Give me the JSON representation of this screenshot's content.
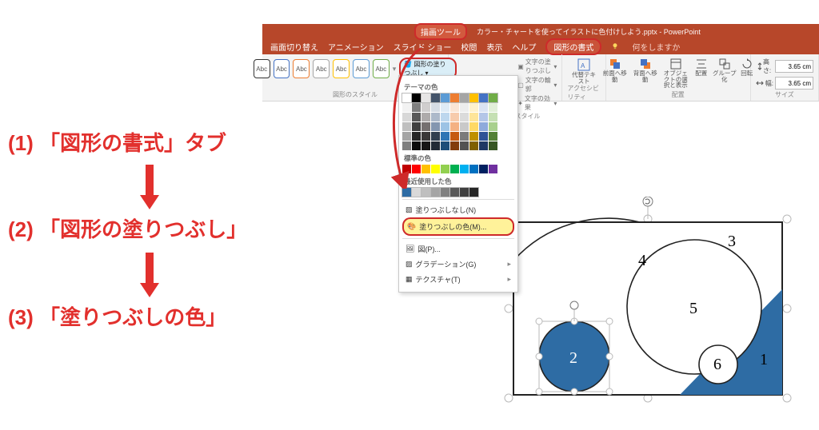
{
  "titlebar": {
    "tool_tab": "描画ツール",
    "doc_title": "カラー・チャートを使ってイラストに色付けしよう.pptx - PowerPoint"
  },
  "tabs": {
    "items": [
      "画面切り替え",
      "アニメーション",
      "スライド ショー",
      "校閲",
      "表示",
      "ヘルプ"
    ],
    "active": "図形の書式",
    "tell_me": "何をしますか"
  },
  "ribbon": {
    "style_label": "Abc",
    "fill_button": "図形の塗りつぶし",
    "shape_styles_group": "図形のスタイル",
    "wordart_group": "ワードアートのスタイル",
    "wa_fill": "文字の塗りつぶし",
    "wa_outline": "文字の輪郭",
    "wa_effects": "文字の効果",
    "alt_text": "代替テキスト",
    "acc_group": "アクセシビリティ",
    "arrange": {
      "forward": "前面へ移動",
      "backward": "背面へ移動",
      "selpane": "オブジェクトの選択と表示",
      "align": "配置",
      "group": "グループ化",
      "rotate": "回転"
    },
    "arrange_group": "配置",
    "size_group": "サイズ",
    "height_label": "高さ:",
    "width_label": "幅:",
    "height": "3.65 cm",
    "width": "3.65 cm"
  },
  "dropdown": {
    "theme_label": "テーマの色",
    "standard_label": "標準の色",
    "recent_label": "最近使用した色",
    "no_fill": "塗りつぶしなし(N)",
    "more_fill": "塗りつぶしの色(M)...",
    "picture": "図(P)...",
    "gradient": "グラデーション(G)",
    "texture": "テクスチャ(T)"
  },
  "annotations": {
    "a1": "(1) 「図形の書式」タブ",
    "a2": "(2) 「図形の塗りつぶし」",
    "a3": "(3) 「塗りつぶしの色」"
  },
  "shape_nums": [
    "1",
    "2",
    "3",
    "4",
    "5",
    "6"
  ],
  "swatches_theme_row1": [
    "#ffffff",
    "#000000",
    "#e7e6e6",
    "#44546a",
    "#5b9bd5",
    "#ed7d31",
    "#a5a5a5",
    "#ffc000",
    "#4472c4",
    "#70ad47"
  ],
  "swatches_theme_tints": [
    [
      "#f2f2f2",
      "#7f7f7f",
      "#d0cece",
      "#d6dce4",
      "#deebf6",
      "#fbe5d5",
      "#ededed",
      "#fff2cc",
      "#dae3f3",
      "#e2efd9"
    ],
    [
      "#d8d8d8",
      "#595959",
      "#aeabab",
      "#adb9ca",
      "#bdd7ee",
      "#f7cbac",
      "#dbdbdb",
      "#fee599",
      "#b4c6e7",
      "#c5e0b3"
    ],
    [
      "#bfbfbf",
      "#3f3f3f",
      "#757070",
      "#8496b0",
      "#9cc3e5",
      "#f4b183",
      "#c9c9c9",
      "#ffd965",
      "#8eaadb",
      "#a8d08d"
    ],
    [
      "#a5a5a5",
      "#262626",
      "#3a3838",
      "#323f4f",
      "#2e75b5",
      "#c55a11",
      "#7b7b7b",
      "#bf9000",
      "#2f5496",
      "#538135"
    ],
    [
      "#7f7f7f",
      "#0c0c0c",
      "#171616",
      "#222a35",
      "#1e4e79",
      "#833c0b",
      "#525252",
      "#7f6000",
      "#1f3864",
      "#375623"
    ]
  ],
  "swatches_standard": [
    "#c00000",
    "#ff0000",
    "#ffc000",
    "#ffff00",
    "#92d050",
    "#00b050",
    "#00b0f0",
    "#0070c0",
    "#002060",
    "#7030a0"
  ],
  "swatches_recent": [
    "#2e6ca4",
    "#d9d9d9",
    "#bfbfbf",
    "#a5a5a5",
    "#808080",
    "#595959",
    "#404040",
    "#262626"
  ]
}
